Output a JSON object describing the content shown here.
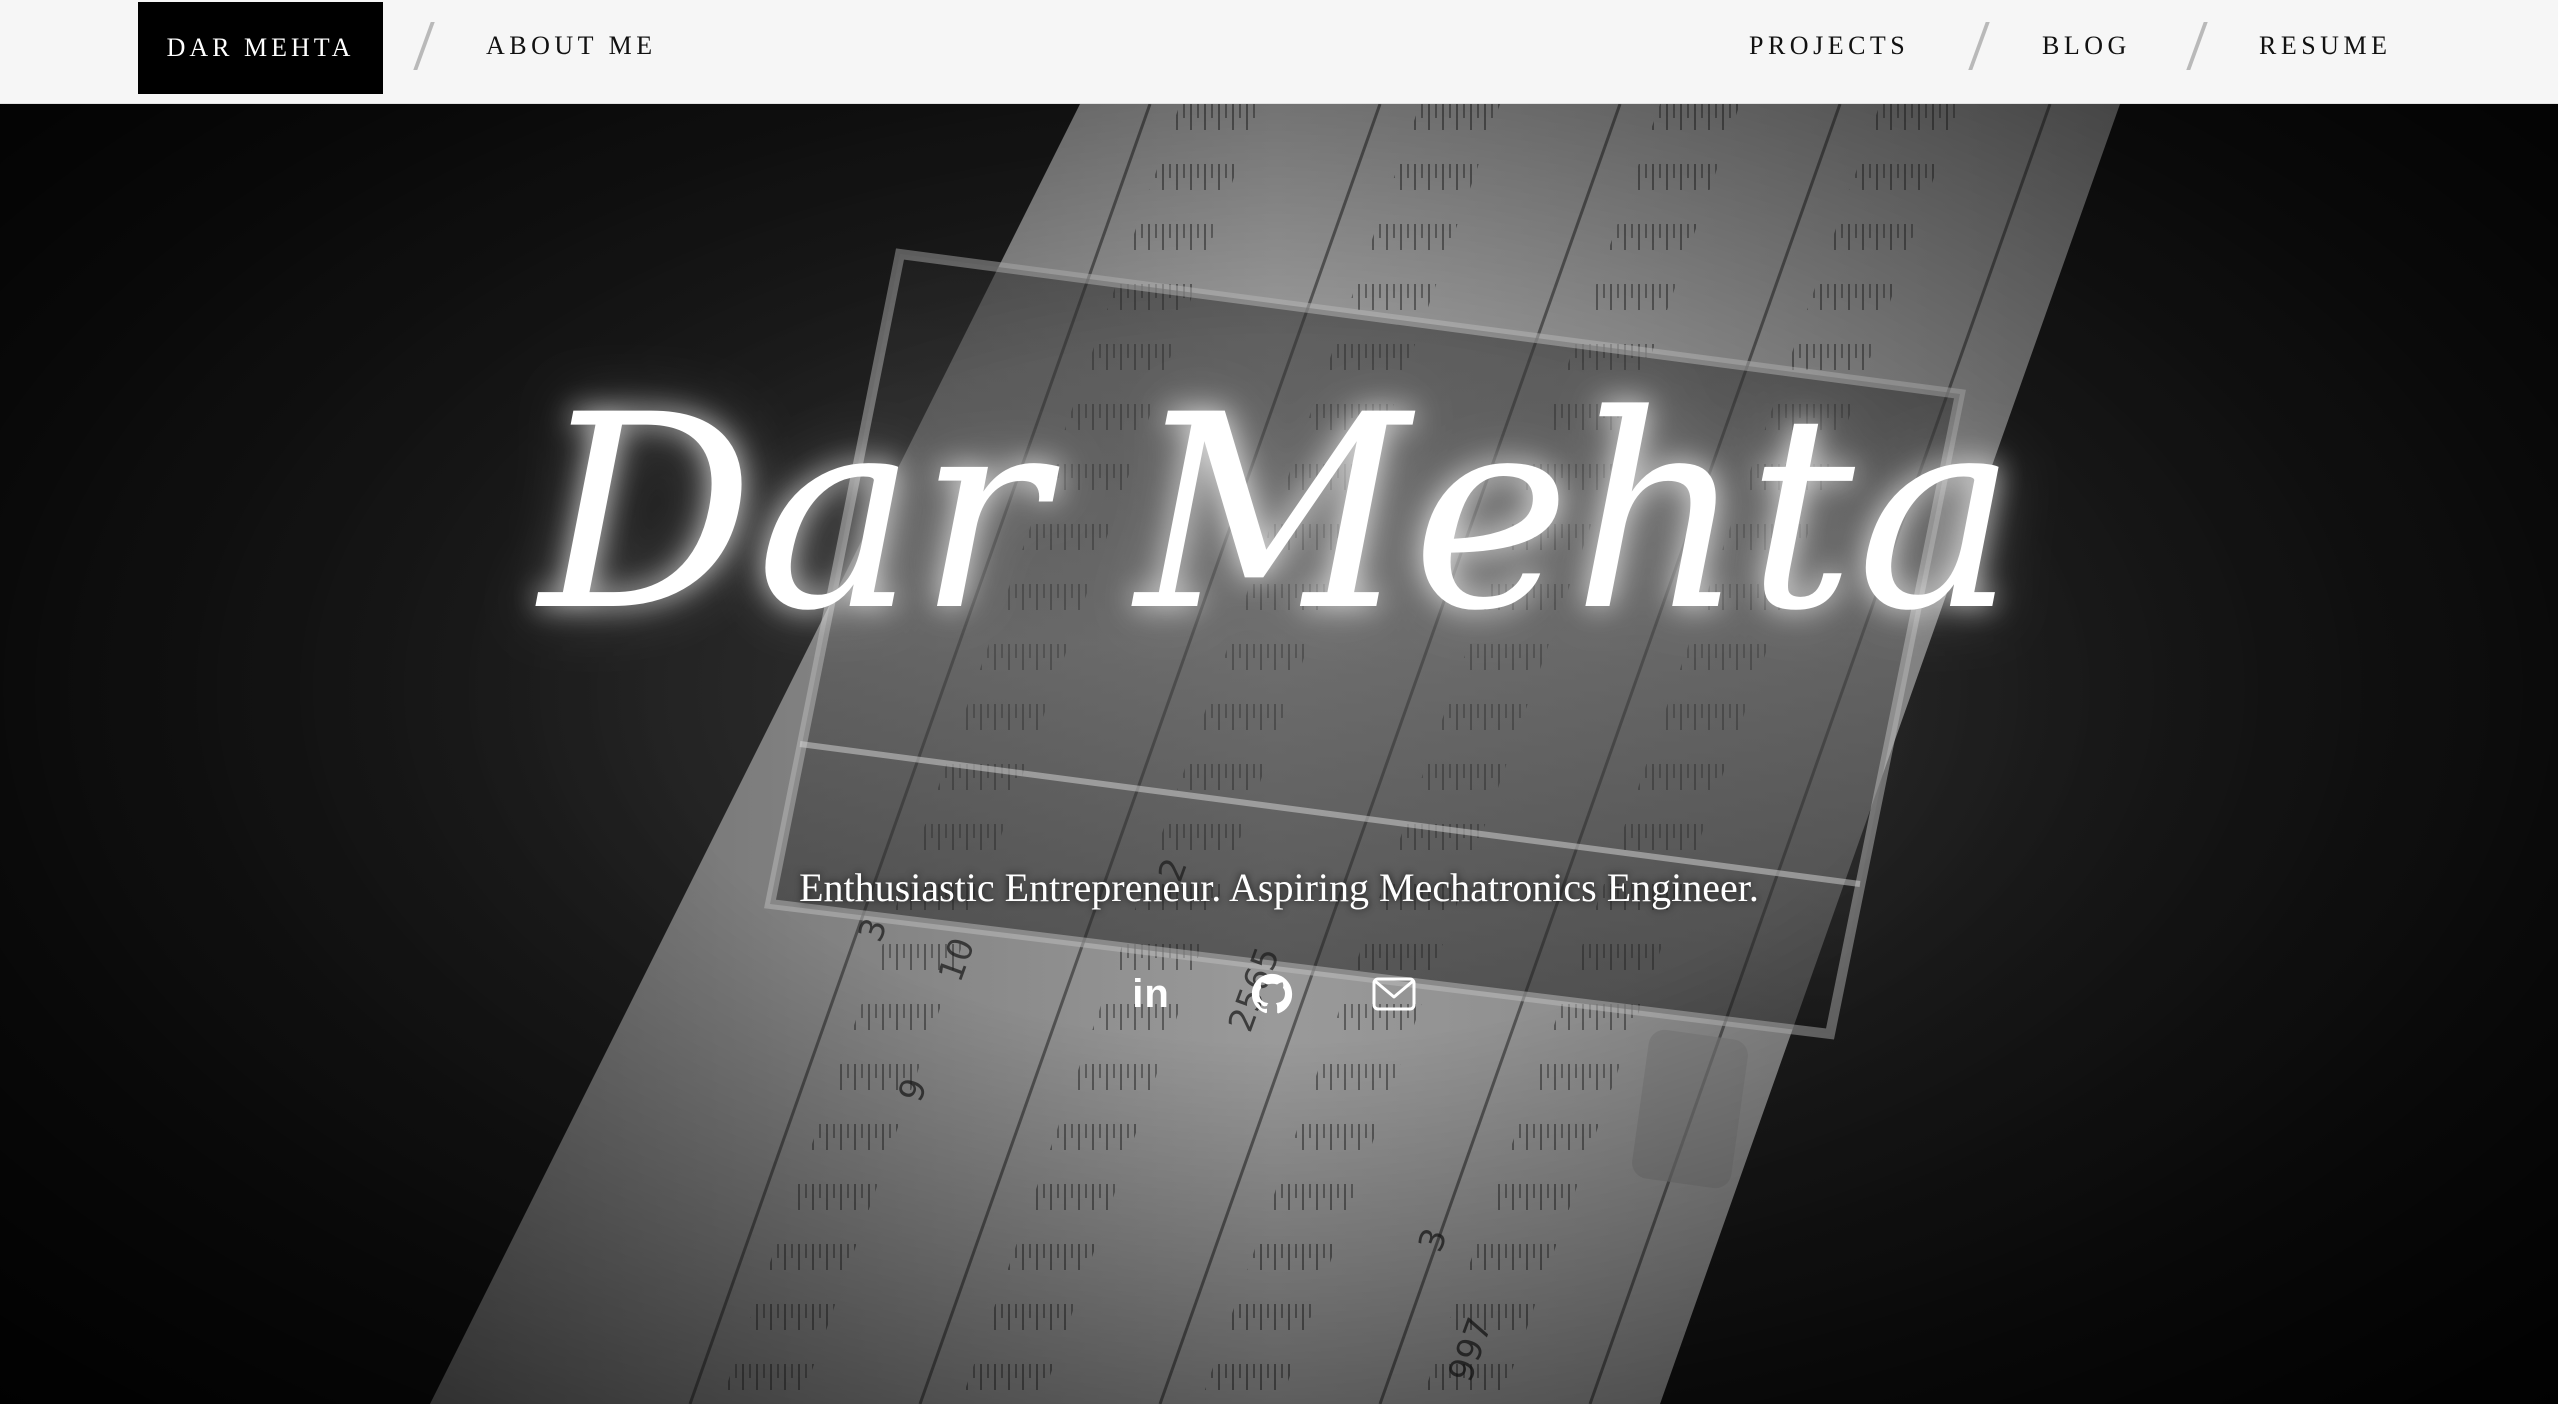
{
  "nav": {
    "brand": "DAR MEHTA",
    "left_links": [
      "ABOUT ME"
    ],
    "right_links": [
      "PROJECTS",
      "BLOG",
      "RESUME"
    ]
  },
  "hero": {
    "title": "Dar Mehta",
    "subtitle": "Enthusiastic Entrepreneur. Aspiring Mechatronics Engineer.",
    "background": "black-and-white photo of a slide rule",
    "social": [
      {
        "icon": "linkedin-icon",
        "glyph": "in"
      },
      {
        "icon": "github-icon"
      },
      {
        "icon": "email-icon"
      }
    ]
  },
  "colors": {
    "nav_bg": "#f6f6f6",
    "brand_bg": "#000000",
    "text_dark": "#111111",
    "text_light": "#ffffff"
  }
}
